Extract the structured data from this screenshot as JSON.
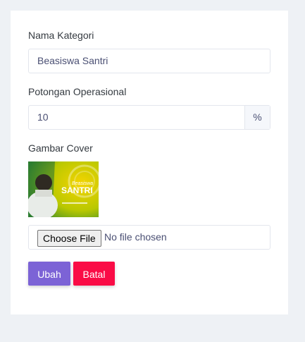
{
  "form": {
    "kategori_label": "Nama Kategori",
    "kategori_value": "Beasiswa Santri",
    "potongan_label": "Potongan Operasional",
    "potongan_value": "10",
    "potongan_suffix": "%",
    "cover_label": "Gambar Cover",
    "cover_image_text_1": "Beasiswa",
    "cover_image_text_2": "SANTRI",
    "file_button_label": "Choose File",
    "file_status": "No file chosen"
  },
  "actions": {
    "submit_label": "Ubah",
    "cancel_label": "Batal"
  },
  "colors": {
    "primary": "#7c63d6",
    "danger": "#fa0c46",
    "background": "#eef1f5"
  }
}
